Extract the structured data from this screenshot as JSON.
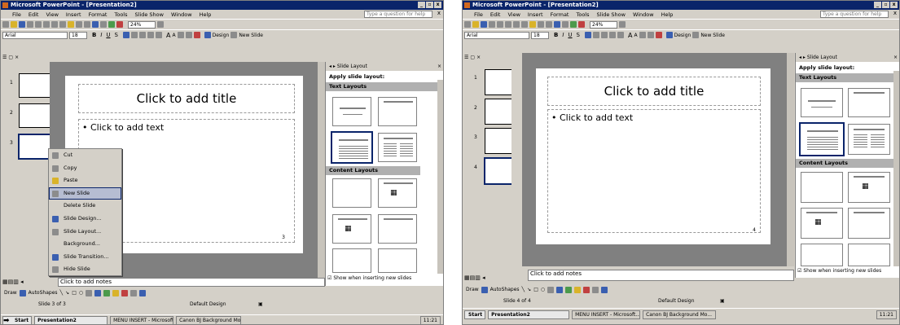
{
  "app": {
    "title": "Microsoft PowerPoint - [Presentation2]",
    "window_buttons": [
      "_",
      "▫",
      "x"
    ]
  },
  "menu": {
    "items": [
      "File",
      "Edit",
      "View",
      "Insert",
      "Format",
      "Tools",
      "Slide Show",
      "Window",
      "Help"
    ],
    "question": "Type a question for help",
    "close": "x"
  },
  "toolbar": {
    "zoom": "24%",
    "font": "Arial",
    "size": "18",
    "bold": "B",
    "italic": "I",
    "underline": "U",
    "shadow": "S",
    "grow": "A",
    "shrink": "A",
    "design": "Design",
    "new_slide": "New Slide"
  },
  "slide": {
    "title": "Click to add title",
    "bullet": "•",
    "text": "Click to add text",
    "notes": "Click to add notes"
  },
  "left": {
    "slide_numbers": [
      "1",
      "2",
      "3"
    ],
    "page_number": "3",
    "status_slide": "Slide 3 of 3",
    "status_design": "Default Design"
  },
  "right": {
    "slide_numbers": [
      "1",
      "2",
      "3",
      "4"
    ],
    "page_number": "4",
    "status_slide": "Slide 4 of 4",
    "status_design": "Default Design"
  },
  "context_menu": {
    "items": [
      "Cut",
      "Copy",
      "Paste",
      "New Slide",
      "Delete Slide",
      "Slide Design...",
      "Slide Layout...",
      "Background...",
      "Slide Transition...",
      "Hide Slide"
    ]
  },
  "task_pane": {
    "title": "Slide Layout",
    "apply": "Apply slide layout:",
    "text_layouts": "Text Layouts",
    "content_layouts": "Content Layouts",
    "show_when": "Show when inserting new slides"
  },
  "drawing": {
    "draw": "Draw",
    "autoshapes": "AutoShapes"
  },
  "taskbar": {
    "start": "Start",
    "apps": [
      "Presentation2",
      "MENU INSERT - Microsoft...",
      "Canon BJ Background Mo..."
    ],
    "time": "11:21"
  }
}
